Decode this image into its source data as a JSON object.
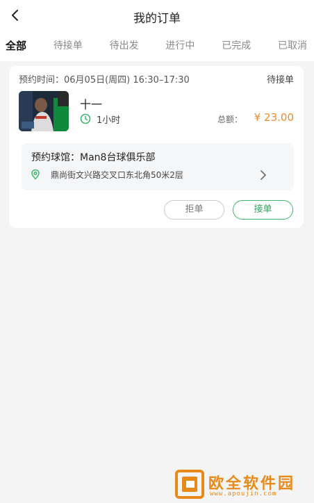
{
  "header": {
    "title": "我的订单"
  },
  "tabs": [
    {
      "label": "全部",
      "active": true
    },
    {
      "label": "待接单",
      "active": false
    },
    {
      "label": "待出发",
      "active": false
    },
    {
      "label": "进行中",
      "active": false
    },
    {
      "label": "已完成",
      "active": false
    },
    {
      "label": "已取消",
      "active": false
    }
  ],
  "order": {
    "appointment": "预约时间：06月05日(周四) 16:30–17:30",
    "status": "待接单",
    "player_name": "十一",
    "duration": "1小时",
    "total_label": "总额：",
    "amount": "¥ 23.00",
    "venue_name": "预约球馆：Man8台球俱乐部",
    "venue_address": "鼎尚街文兴路交叉口东北角50米2层",
    "reject_label": "拒单",
    "accept_label": "接单"
  },
  "watermark": {
    "brand": "欧全软件园",
    "url": "www.apoujin.com"
  },
  "colors": {
    "accent_green": "#3fb56b",
    "amount_orange": "#f08a2c",
    "watermark_orange": "#e88a1a"
  },
  "icons": [
    "back-arrow-icon",
    "clock-icon",
    "location-pin-icon",
    "chevron-right-icon"
  ]
}
